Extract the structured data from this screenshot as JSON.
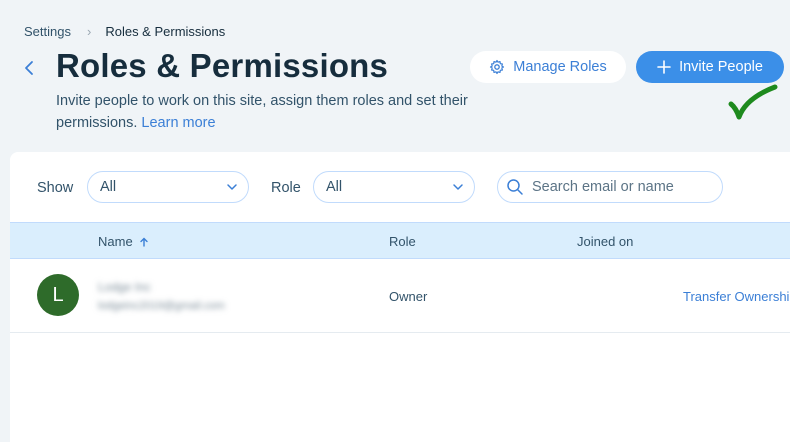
{
  "breadcrumb": {
    "parent": "Settings",
    "current": "Roles & Permissions"
  },
  "header": {
    "title": "Roles & Permissions",
    "subtitle": "Invite people to work on this site, assign them roles and set their permissions.",
    "learn_more": "Learn more",
    "manage_roles": "Manage Roles",
    "invite_people": "Invite People"
  },
  "filters": {
    "show_label": "Show",
    "show_value": "All",
    "role_label": "Role",
    "role_value": "All",
    "search_placeholder": "Search email or name"
  },
  "table": {
    "columns": {
      "name": "Name",
      "role": "Role",
      "joined": "Joined on"
    },
    "rows": [
      {
        "avatar_letter": "L",
        "name": "Lodge Inc",
        "email": "lodgeinc2019@gmail.com",
        "role": "Owner",
        "action": "Transfer Ownership"
      }
    ]
  },
  "colors": {
    "accent": "#3b8fe8",
    "link": "#3b7fd6",
    "avatar": "#2e6b2a",
    "header_bg": "#daeefd",
    "check": "#1e8a1e"
  }
}
